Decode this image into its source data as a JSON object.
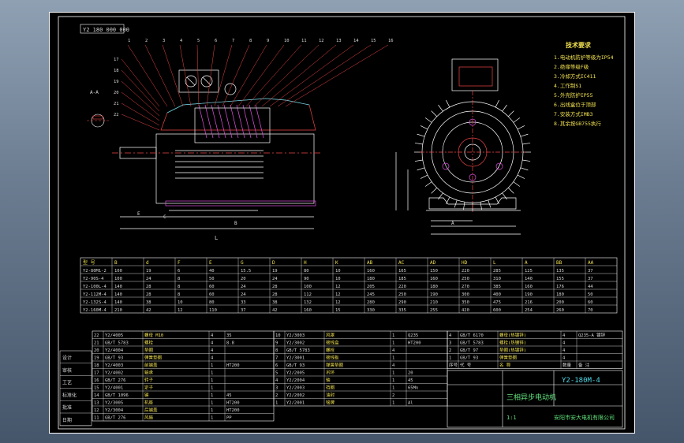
{
  "drawing": {
    "title_tag": "Y2 180 000 000",
    "tech_requirements_title": "技术要求",
    "tech_lines": [
      "1.电动机防护等级为IP54",
      "2.绝缘等级F级",
      "3.冷却方式IC411",
      "4.工作制S1",
      "5.外壳防护IP55",
      "6.出线盒位于顶部",
      "7.安装方式IMB3",
      "8.其余按GB755执行"
    ],
    "motor_name": "三相异步电动机",
    "drawing_no": "Y2-180M-4",
    "company": "安阳市安大电机有限公司",
    "scale_label": "1:1",
    "dim_L": "L",
    "dim_E": "E",
    "dim_C": "C",
    "dim_B": "B",
    "dim_A": "A",
    "section_label": "A-A"
  },
  "part_table": {
    "headers": [
      "型 号",
      "B",
      "d",
      "F",
      "E",
      "G",
      "D",
      "H",
      "K",
      "AB",
      "AC",
      "AD",
      "HD",
      "L",
      "A",
      "BB",
      "AA"
    ],
    "rows": [
      [
        "Y2-80M1-2",
        "100",
        "19",
        "6",
        "40",
        "15.5",
        "19",
        "80",
        "10",
        "160",
        "165",
        "150",
        "220",
        "285",
        "125",
        "135",
        "37"
      ],
      [
        "Y2-90S-4",
        "100",
        "24",
        "8",
        "50",
        "20",
        "24",
        "90",
        "10",
        "180",
        "185",
        "160",
        "250",
        "310",
        "140",
        "155",
        "37"
      ],
      [
        "Y2-100L-4",
        "140",
        "28",
        "8",
        "60",
        "24",
        "28",
        "100",
        "12",
        "205",
        "220",
        "180",
        "270",
        "385",
        "160",
        "176",
        "44"
      ],
      [
        "Y2-112M-4",
        "140",
        "28",
        "8",
        "60",
        "24",
        "28",
        "112",
        "12",
        "245",
        "250",
        "190",
        "300",
        "400",
        "190",
        "180",
        "50"
      ],
      [
        "Y2-132S-4",
        "140",
        "38",
        "10",
        "80",
        "33",
        "38",
        "132",
        "12",
        "280",
        "290",
        "210",
        "350",
        "475",
        "216",
        "200",
        "60"
      ],
      [
        "Y2-160M-4",
        "210",
        "42",
        "12",
        "110",
        "37",
        "42",
        "160",
        "15",
        "330",
        "335",
        "255",
        "420",
        "600",
        "254",
        "260",
        "70"
      ]
    ]
  },
  "bom_left": {
    "rows": [
      [
        "22",
        "Y2/4005",
        "螺母 M10",
        "4",
        "35"
      ],
      [
        "21",
        "GB/T 5783",
        "螺栓",
        "4",
        "8.8"
      ],
      [
        "20",
        "Y2/4004",
        "垫圈",
        "4",
        ""
      ],
      [
        "19",
        "GB/T 93",
        "弹簧垫圈",
        "4",
        ""
      ],
      [
        "18",
        "Y2/4003",
        "前端盖",
        "1",
        "HT200"
      ],
      [
        "17",
        "Y2/4002",
        "轴承",
        "1",
        ""
      ],
      [
        "16",
        "GB/T 276",
        "转子",
        "1",
        ""
      ],
      [
        "15",
        "Y2/4001",
        "定子",
        "1",
        ""
      ],
      [
        "14",
        "GB/T 1096",
        "键",
        "1",
        "45"
      ],
      [
        "13",
        "Y2/3005",
        "机座",
        "1",
        "HT200"
      ],
      [
        "12",
        "Y2/3004",
        "后端盖",
        "1",
        "HT200"
      ],
      [
        "11",
        "GB/T 276",
        "风扇",
        "1",
        "PP"
      ]
    ]
  },
  "bom_mid": {
    "rows": [
      [
        "10",
        "Y2/3003",
        "风罩",
        "1",
        "Q235"
      ],
      [
        "9",
        "Y2/3002",
        "接线盒",
        "1",
        "HT200"
      ],
      [
        "8",
        "GB/T 5783",
        "螺栓",
        "4",
        ""
      ],
      [
        "7",
        "Y2/3001",
        "接线板",
        "1",
        ""
      ],
      [
        "6",
        "GB/T 93",
        "弹簧垫圈",
        "4",
        ""
      ],
      [
        "5",
        "Y2/2005",
        "吊环",
        "1",
        "20"
      ],
      [
        "4",
        "Y2/2004",
        "轴",
        "1",
        "45"
      ],
      [
        "3",
        "Y2/2003",
        "挡圈",
        "1",
        "65Mn"
      ],
      [
        "2",
        "Y2/2002",
        "油封",
        "2",
        ""
      ],
      [
        "1",
        "Y2/2001",
        "铭牌",
        "1",
        "Al"
      ]
    ]
  },
  "bom_right": {
    "rows": [
      [
        "4",
        "GB/T 6170",
        "螺母(热镀锌)",
        "4",
        "Q235-A 镀锌"
      ],
      [
        "3",
        "GB/T 5783",
        "螺栓(热镀锌)",
        "4",
        ""
      ],
      [
        "2",
        "GB/T 97",
        "垫圈(热镀锌)",
        "4",
        ""
      ],
      [
        "1",
        "GB/T 93",
        "弹簧垫圈",
        "4",
        ""
      ],
      [
        "序号",
        "代 号",
        "名 称",
        "数量",
        "备 注"
      ]
    ]
  },
  "sign_block": {
    "labels": [
      "设计",
      "审核",
      "工艺",
      "标准化",
      "批准",
      "日期"
    ]
  },
  "leaders_left": [
    "1",
    "2",
    "3",
    "4",
    "5",
    "6",
    "7",
    "8",
    "9",
    "10",
    "11",
    "12",
    "13",
    "14",
    "15",
    "16",
    "17",
    "18",
    "19",
    "20",
    "21",
    "22"
  ]
}
